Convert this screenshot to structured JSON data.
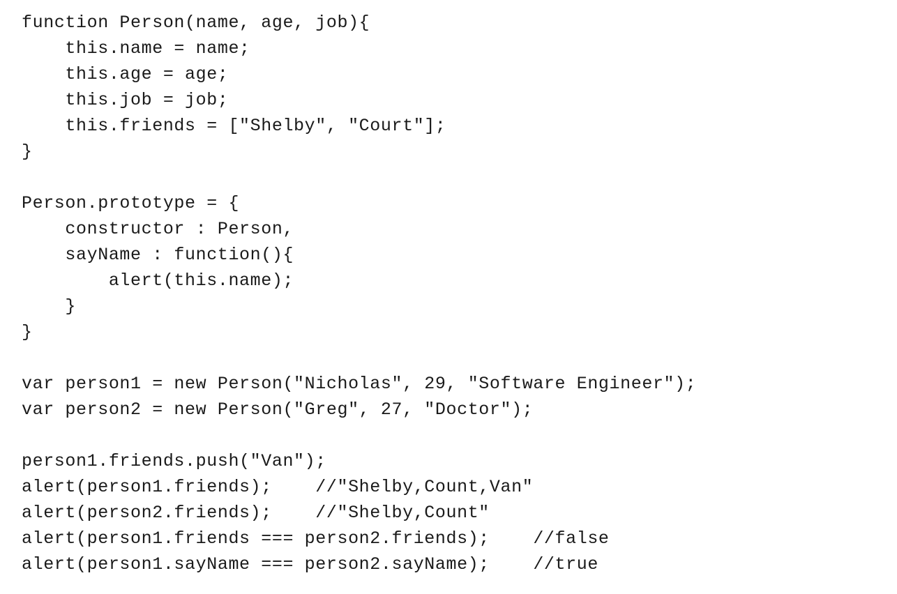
{
  "code": {
    "lines": [
      "function Person(name, age, job){",
      "    this.name = name;",
      "    this.age = age;",
      "    this.job = job;",
      "    this.friends = [\"Shelby\", \"Court\"];",
      "}",
      "",
      "Person.prototype = {",
      "    constructor : Person,",
      "    sayName : function(){",
      "        alert(this.name);",
      "    }",
      "}",
      "",
      "var person1 = new Person(\"Nicholas\", 29, \"Software Engineer\");",
      "var person2 = new Person(\"Greg\", 27, \"Doctor\");",
      "",
      "person1.friends.push(\"Van\");",
      "alert(person1.friends);    //\"Shelby,Count,Van\"",
      "alert(person2.friends);    //\"Shelby,Count\"",
      "alert(person1.friends === person2.friends);    //false",
      "alert(person1.sayName === person2.sayName);    //true"
    ]
  }
}
